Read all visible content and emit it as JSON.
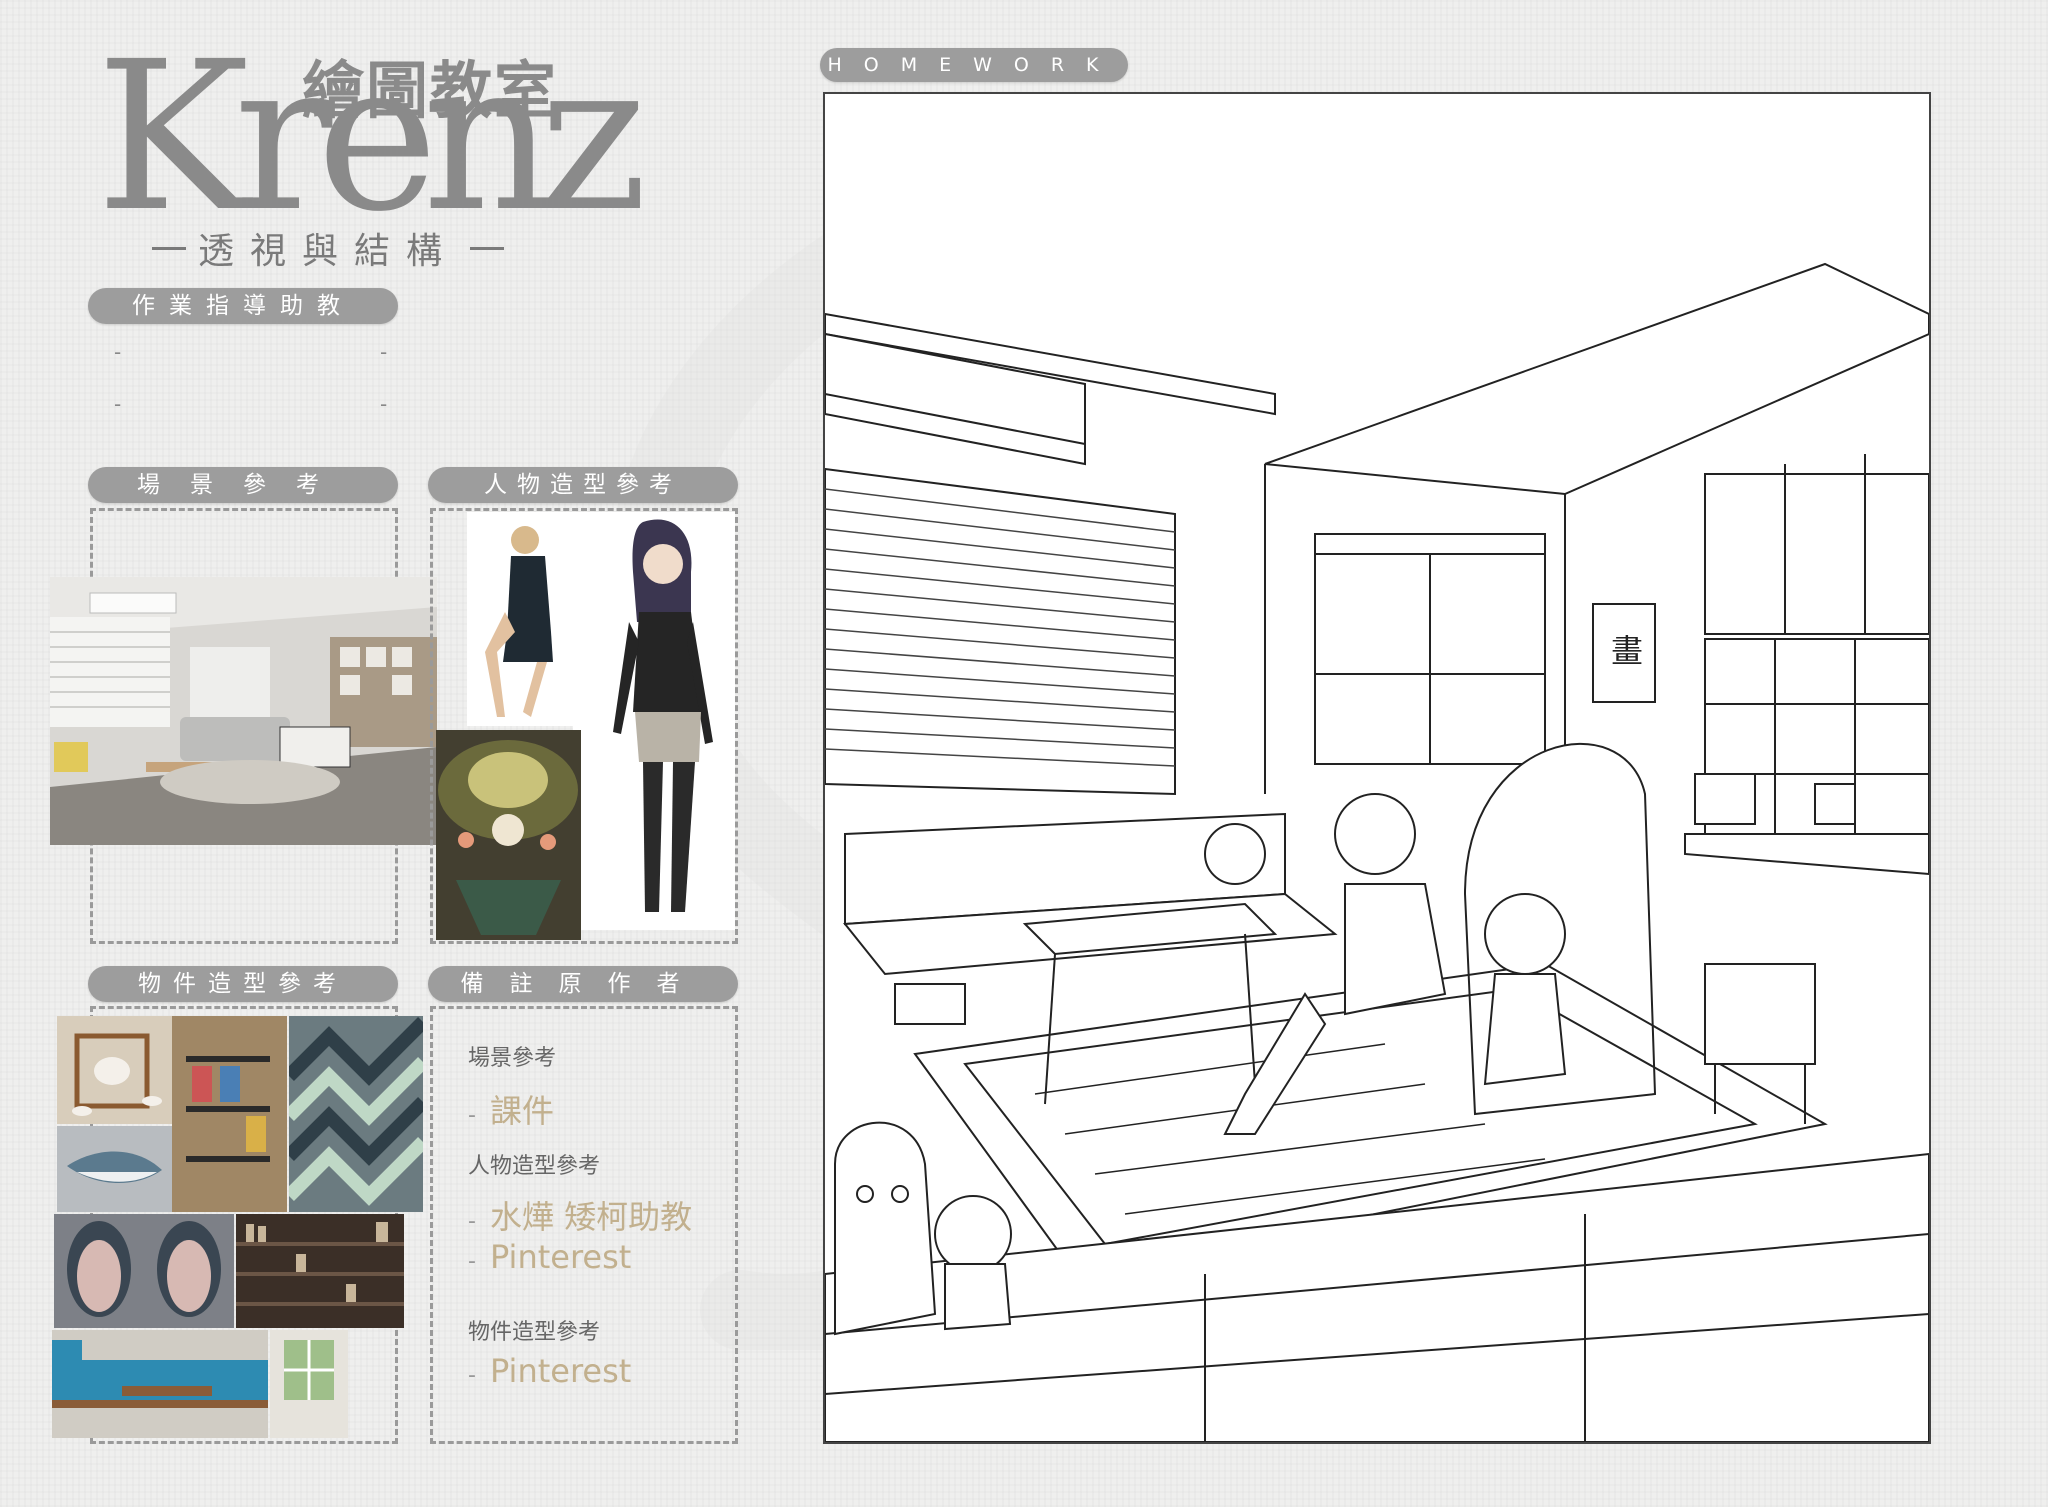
{
  "logo": {
    "cjk_title": "繪圖教室",
    "brand": "Krenz",
    "subtitle": "透視與結構"
  },
  "sections": {
    "tutor": {
      "label": "作業指導助教",
      "slots": [
        "-",
        "-",
        "-",
        "-"
      ]
    },
    "scene_ref": {
      "label": "場景參考"
    },
    "character_ref": {
      "label": "人物造型參考"
    },
    "object_ref": {
      "label": "物件造型參考"
    },
    "credits": {
      "label": "備註原作者"
    },
    "homework": {
      "label": "HOMEWORK"
    }
  },
  "credits": {
    "scene_heading": "場景參考",
    "scene_items": [
      "課件"
    ],
    "character_heading": "人物造型參考",
    "character_items": [
      "水燁 矮柯助教",
      "Pinterest"
    ],
    "object_heading": "物件造型參考",
    "object_items": [
      "Pinterest"
    ]
  },
  "icons": {
    "artwork": "line-art-interior-scene-icon",
    "scene_photo": "living-room-photo-icon",
    "character_photo": "woman-seated-photo-icon",
    "character_illustration": "anime-girl-illustration-icon",
    "character_painting": "fantasy-painting-icon",
    "object_teaset": "tea-set-photo-icon",
    "object_shelf": "magazine-rack-photo-icon",
    "object_rug": "chevron-rug-photo-icon",
    "object_shark": "shark-plush-photo-icon",
    "object_pod": "pod-chair-photo-icon",
    "object_bookcase": "bookcase-photo-icon",
    "object_sofa": "blue-sofa-photo-icon",
    "object_window": "window-photo-icon"
  },
  "colors": {
    "pill": "#9d9d9d",
    "logo": "#8a8a8a",
    "credit_link": "#c2b08e",
    "background": "#efefee"
  }
}
